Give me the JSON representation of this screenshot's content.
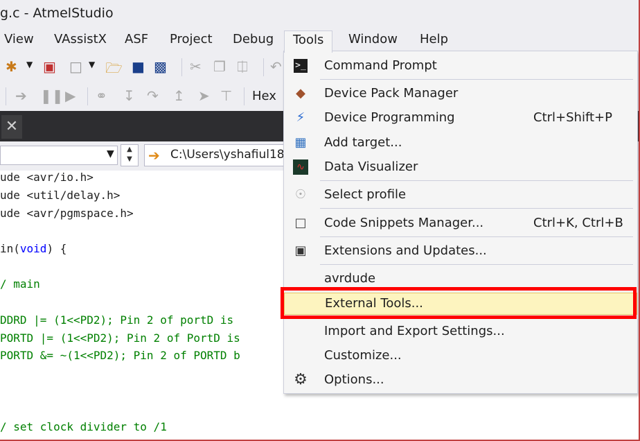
{
  "window": {
    "title": "g.c - AtmelStudio"
  },
  "menubar": {
    "items": [
      "View",
      "VAssistX",
      "ASF",
      "Project",
      "Debug",
      "Tools",
      "Window",
      "Help"
    ],
    "active": "Tools"
  },
  "toolbar2": {
    "hex_label": "Hex"
  },
  "navbar": {
    "path": "C:\\Users\\yshafiul18"
  },
  "editor": {
    "lines": [
      {
        "text": "ude <avr/io.h>",
        "style": "pp",
        "prefix": "ude",
        "rest": " <avr/io.h>"
      },
      {
        "text": "ude <util/delay.h>",
        "prefix": "ude",
        "rest": " <util/delay.h>"
      },
      {
        "text": "ude <avr/pgmspace.h>",
        "prefix": "ude",
        "rest": " <avr/pgmspace.h>"
      },
      {
        "text": ""
      },
      {
        "text": "in(void) {",
        "prefix": "in(",
        "kw": "void",
        "rest": ") {"
      },
      {
        "text": ""
      },
      {
        "text": "/ main",
        "comment": true
      },
      {
        "text": ""
      },
      {
        "text": "DDRD |= (1<<PD2); Pin 2 of portD is",
        "comment": true
      },
      {
        "text": "PORTD |= (1<<PD2); Pin 2 of PortD is",
        "comment": true
      },
      {
        "text": "PORTD &= ~(1<<PD2); Pin 2 of PORTD b",
        "comment": true
      },
      {
        "text": ""
      },
      {
        "text": ""
      },
      {
        "text": ""
      },
      {
        "text": "/ set clock divider to /1",
        "comment": true
      }
    ]
  },
  "tools_menu": {
    "items": [
      {
        "label": "Command Prompt",
        "icon": "command-prompt-icon",
        "shortcut": ""
      },
      {
        "label": "Device Pack Manager",
        "icon": "package-icon",
        "shortcut": ""
      },
      {
        "label": "Device Programming",
        "icon": "device-programming-icon",
        "shortcut": "Ctrl+Shift+P"
      },
      {
        "label": "Add target...",
        "icon": "add-target-icon",
        "shortcut": ""
      },
      {
        "label": "Data Visualizer",
        "icon": "data-visualizer-icon",
        "shortcut": ""
      },
      {
        "label": "Select profile",
        "icon": "select-profile-icon",
        "shortcut": ""
      },
      {
        "label": "Code Snippets Manager...",
        "icon": "code-snippets-icon",
        "shortcut": "Ctrl+K, Ctrl+B"
      },
      {
        "label": "Extensions and Updates...",
        "icon": "extensions-icon",
        "shortcut": ""
      },
      {
        "label": "avrdude",
        "icon": "",
        "shortcut": ""
      },
      {
        "label": "External Tools...",
        "icon": "",
        "shortcut": ""
      },
      {
        "label": "Import and Export Settings...",
        "icon": "",
        "shortcut": ""
      },
      {
        "label": "Customize...",
        "icon": "",
        "shortcut": ""
      },
      {
        "label": "Options...",
        "icon": "gear-icon",
        "shortcut": ""
      }
    ],
    "highlighted": "External Tools..."
  },
  "colors": {
    "highlight_bg": "#fdf4bf",
    "annotation_red": "#ff0000",
    "comment": "#008000",
    "keyword": "#0000ff"
  }
}
